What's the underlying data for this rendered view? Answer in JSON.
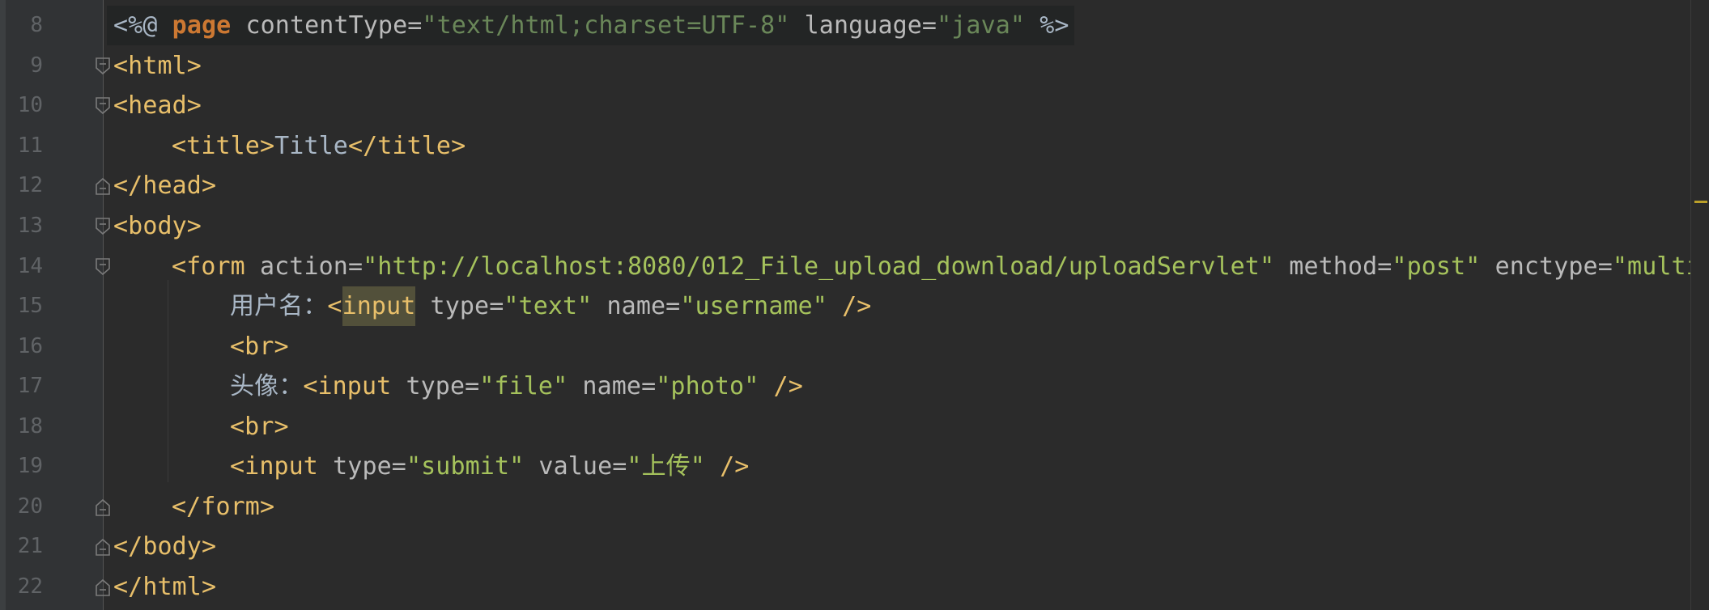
{
  "editor": {
    "lines": [
      {
        "num": "8",
        "t1": "<%@ ",
        "t2": "page",
        "t3": " contentType=",
        "t4": "\"text/html;charset=UTF-8\"",
        "t5": " language=",
        "t6": "\"java\"",
        "t7": " %>"
      },
      {
        "num": "9",
        "t1": "<html>"
      },
      {
        "num": "10",
        "t1": "<head>"
      },
      {
        "num": "11",
        "t1": "<title>",
        "t2": "Title",
        "t3": "</title>"
      },
      {
        "num": "12",
        "t1": "</head>"
      },
      {
        "num": "13",
        "t1": "<body>"
      },
      {
        "num": "14",
        "t1": "<form",
        "t2": " action=",
        "t3": "\"http://localhost:8080/012_File_upload_download/uploadServlet\"",
        "t4": " method=",
        "t5": "\"post\"",
        "t6": " enctype=",
        "t7": "\"multip"
      },
      {
        "num": "15",
        "t1": "用户名：",
        "t2": "<",
        "t3": "input",
        "t4": " type=",
        "t5": "\"text\"",
        "t6": " name=",
        "t7": "\"username\"",
        "t8": " />"
      },
      {
        "num": "16",
        "t1": "<br>"
      },
      {
        "num": "17",
        "t1": "头像：",
        "t2": "<input",
        "t3": " type=",
        "t4": "\"file\"",
        "t5": " name=",
        "t6": "\"photo\"",
        "t7": " />"
      },
      {
        "num": "18",
        "t1": "<br>"
      },
      {
        "num": "19",
        "t1": "<input",
        "t2": " type=",
        "t3": "\"submit\"",
        "t4": " value=",
        "t5": "\"上传\"",
        "t6": " />"
      },
      {
        "num": "20",
        "t1": "</form>"
      },
      {
        "num": "21",
        "t1": "</body>"
      },
      {
        "num": "22",
        "t1": "</html>"
      }
    ]
  },
  "icons": {
    "fold_expanded": "fold-collapse-icon",
    "fold_end": "fold-end-icon"
  },
  "colors": {
    "background": "#2b2b2b",
    "gutter": "#313335",
    "line_number": "#606366",
    "tag": "#e8bf6a",
    "attribute": "#bababa",
    "value": "#a5c25c",
    "keyword": "#cc7832",
    "text": "#a9b7c6"
  }
}
